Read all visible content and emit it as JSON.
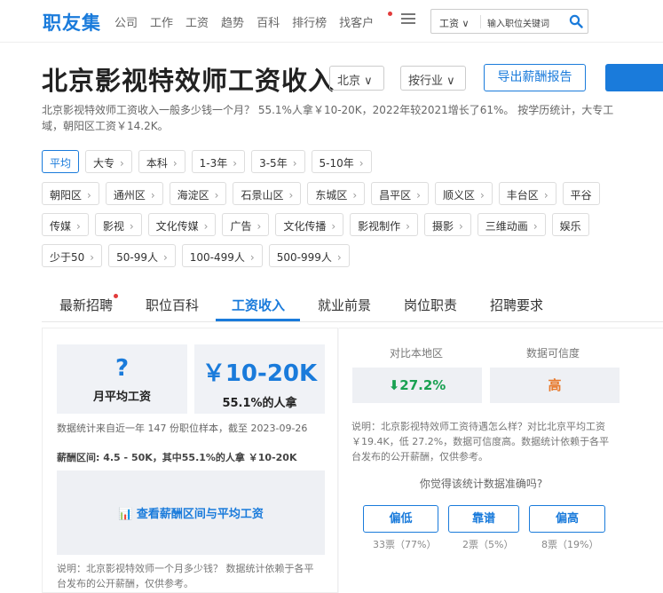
{
  "nav": {
    "logo": "职友集",
    "links": [
      "公司",
      "工作",
      "工资",
      "趋势",
      "百科",
      "排行榜",
      "找客户"
    ],
    "search_type": "工资 ∨",
    "search_placeholder": "输入职位关键词"
  },
  "header": {
    "title": "北京影视特效师工资收入",
    "city": "北京 ∨",
    "industry": "按行业 ∨",
    "export_label": "导出薪酬报告",
    "summary_line1": "北京影视特效师工资收入一般多少钱一个月？ 55.1%人拿￥10-20K，2022年较2021增长了61%。 按学历统计，大专工",
    "summary_line2": "域，朝阳区工资￥14.2K。"
  },
  "filters": {
    "row1": [
      "平均",
      "大专",
      "本科",
      "1-3年",
      "3-5年",
      "5-10年"
    ],
    "row2": [
      "朝阳区",
      "通州区",
      "海淀区",
      "石景山区",
      "东城区",
      "昌平区",
      "顺义区",
      "丰台区",
      "平谷"
    ],
    "row3": [
      "传媒",
      "影视",
      "文化传媒",
      "广告",
      "文化传播",
      "影视制作",
      "摄影",
      "三维动画",
      "娱乐"
    ],
    "row4": [
      "少于50",
      "50-99人",
      "100-499人",
      "500-999人"
    ]
  },
  "tabs": [
    "最新招聘",
    "职位百科",
    "工资收入",
    "就业前景",
    "岗位职责",
    "招聘要求"
  ],
  "left": {
    "avg_value": "?",
    "avg_caption": "月平均工资",
    "range_value": "￥10-20K",
    "range_caption": "55.1%的人拿",
    "source_note": "数据统计来自近一年 147 份职位样本，截至 2023-09-26",
    "range_note": "薪酬区间: 4.5 - 50K，其中55.1%的人拿 ￥10-20K",
    "cta": "查看薪酬区间与平均工资",
    "foot": "说明：北京影视特效师一个月多少钱？ 数据统计依赖于各平台发布的公开薪酬，仅供参考。"
  },
  "right": {
    "compare_label": "对比本地区",
    "trust_label": "数据可信度",
    "compare_value": "27.2%",
    "trust_value": "高",
    "note": "说明：北京影视特效师工资待遇怎么样？对比北京平均工资￥19.4K，低 27.2%，数据可信度高。数据统计依赖于各平台发布的公开薪酬，仅供参考。",
    "question": "你觉得该统计数据准确吗?",
    "votes": [
      {
        "label": "偏低",
        "count": "33票（77%）"
      },
      {
        "label": "靠谱",
        "count": "2票（5%）"
      },
      {
        "label": "偏高",
        "count": "8票（19%）"
      }
    ]
  },
  "colors": {
    "brand": "#1a7bdb",
    "down": "#1aa152",
    "high": "#e8792b"
  }
}
